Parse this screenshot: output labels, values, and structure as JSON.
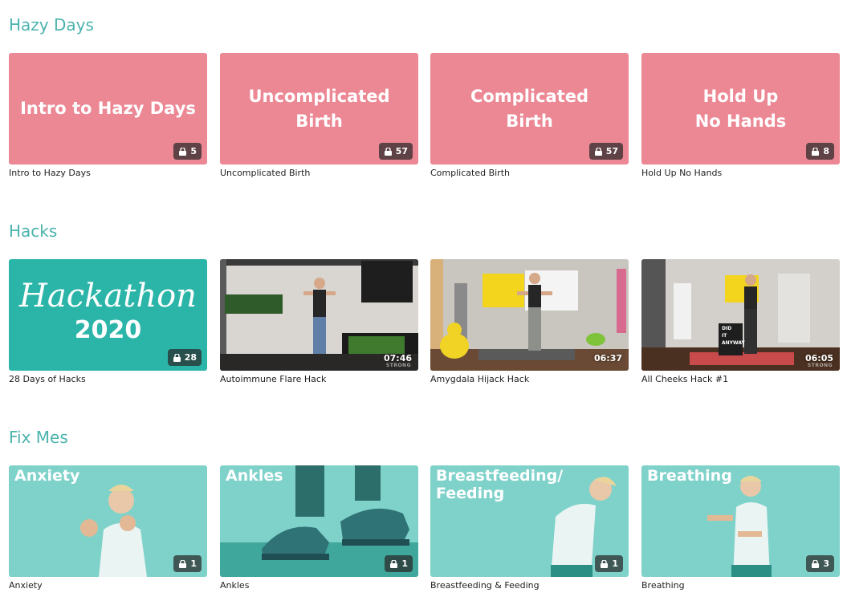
{
  "sections": [
    {
      "title": "Hazy Days",
      "cards": [
        {
          "thumb_text": "Intro to Hazy Days",
          "count": "5",
          "caption": "Intro to Hazy Days"
        },
        {
          "thumb_text": "Uncomplicated\nBirth",
          "count": "57",
          "caption": "Uncomplicated Birth"
        },
        {
          "thumb_text": "Complicated\nBirth",
          "count": "57",
          "caption": "Complicated Birth"
        },
        {
          "thumb_text": "Hold Up\nNo Hands",
          "count": "8",
          "caption": "Hold Up No Hands"
        }
      ]
    },
    {
      "title": "Hacks",
      "cards": [
        {
          "thumb_script": "Hackathon",
          "thumb_year": "2020",
          "count": "28",
          "caption": "28 Days of Hacks"
        },
        {
          "duration": "07:46",
          "duration_sub": "STRONG",
          "caption": "Autoimmune Flare Hack"
        },
        {
          "duration": "06:37",
          "caption": "Amygdala Hijack Hack"
        },
        {
          "duration": "06:05",
          "duration_sub": "STRONG",
          "poster_text": "DID\nIT\nANYWAY",
          "caption": "All Cheeks Hack #1"
        }
      ]
    },
    {
      "title": "Fix Mes",
      "cards": [
        {
          "thumb_text": "Anxiety",
          "count": "1",
          "caption": "Anxiety"
        },
        {
          "thumb_text": "Ankles",
          "count": "1",
          "caption": "Ankles"
        },
        {
          "thumb_text": "Breastfeeding/\nFeeding",
          "count": "1",
          "caption": "Breastfeeding & Feeding"
        },
        {
          "thumb_text": "Breathing",
          "count": "3",
          "caption": "Breathing"
        }
      ]
    }
  ],
  "icons": {
    "badge_icon": "lock-icon"
  },
  "colors": {
    "heading": "#4bb3ad",
    "pink_tile": "#ec8794",
    "teal_tile": "#2bb5a8",
    "mint_tile": "#7fd2ca"
  }
}
